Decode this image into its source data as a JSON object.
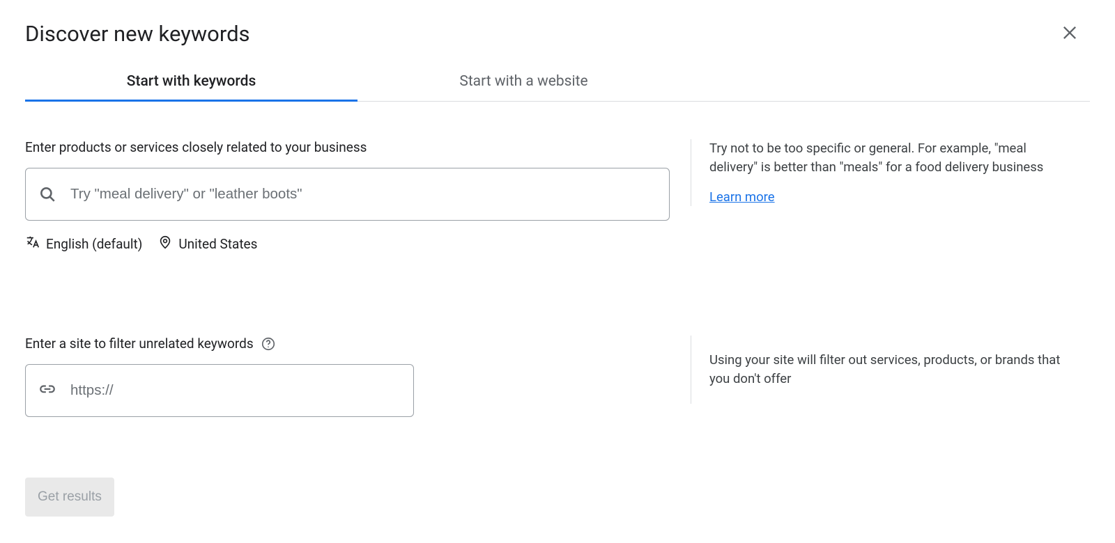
{
  "header": {
    "title": "Discover new keywords"
  },
  "tabs": [
    {
      "label": "Start with keywords",
      "active": true
    },
    {
      "label": "Start with a website",
      "active": false
    }
  ],
  "keywords_section": {
    "label": "Enter products or services closely related to your business",
    "placeholder": "Try \"meal delivery\" or \"leather boots\"",
    "tip": "Try not to be too specific or general. For example, \"meal delivery\" is better than \"meals\" for a food delivery business",
    "learn_more": "Learn more",
    "language": "English (default)",
    "location": "United States"
  },
  "site_section": {
    "label": "Enter a site to filter unrelated keywords",
    "placeholder": "https://",
    "tip": "Using your site will filter out services, products, or brands that you don't offer"
  },
  "footer": {
    "get_results": "Get results"
  }
}
